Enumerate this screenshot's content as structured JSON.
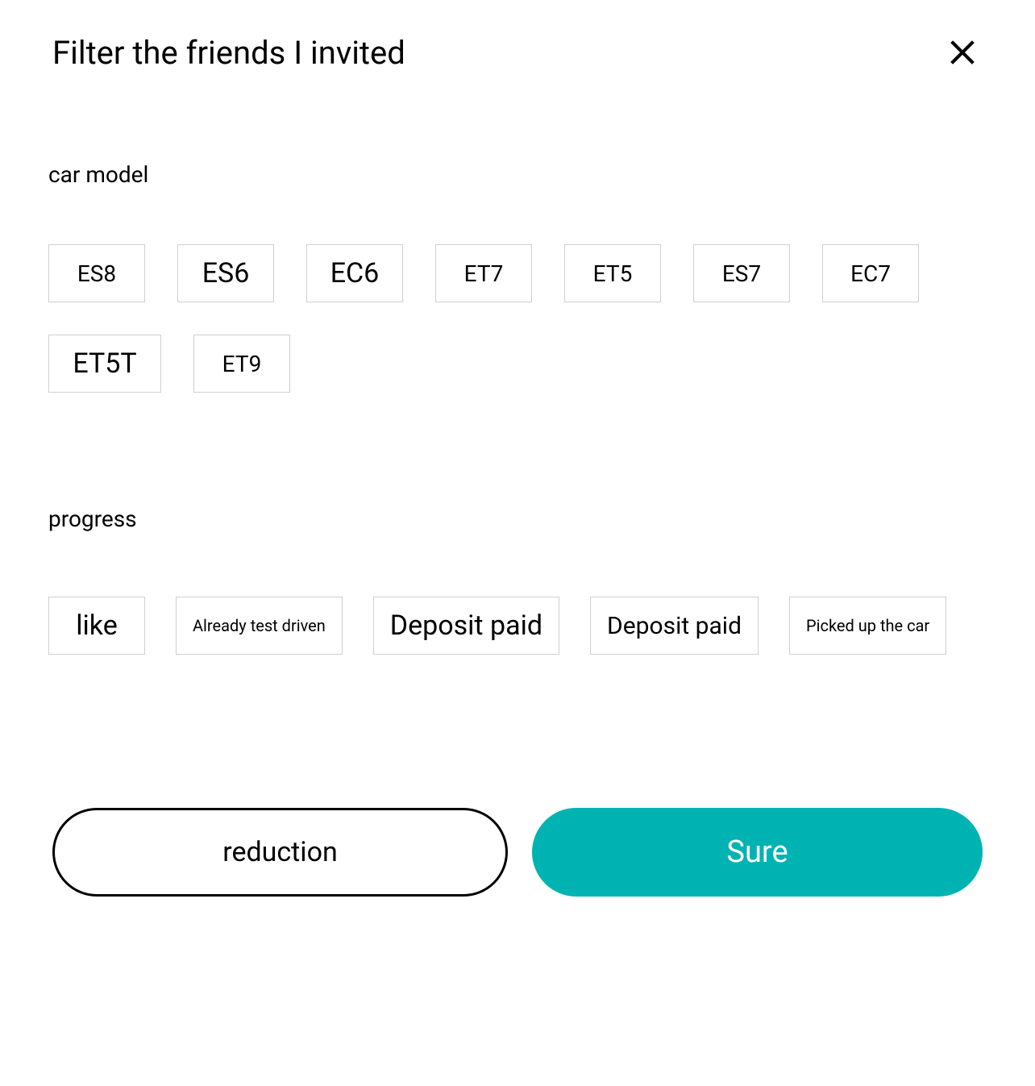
{
  "header": {
    "title": "Filter the friends I invited"
  },
  "sections": {
    "car_model": {
      "label": "car model",
      "options": [
        "ES8",
        "ES6",
        "EC6",
        "ET7",
        "ET5",
        "ES7",
        "EC7",
        "ET5T",
        "ET9"
      ]
    },
    "progress": {
      "label": "progress",
      "options": [
        "like",
        "Already test driven",
        "Deposit paid",
        "Deposit paid",
        "Picked up the car"
      ]
    }
  },
  "footer": {
    "secondary": "reduction",
    "primary": "Sure"
  },
  "colors": {
    "primary": "#00b3b3"
  }
}
